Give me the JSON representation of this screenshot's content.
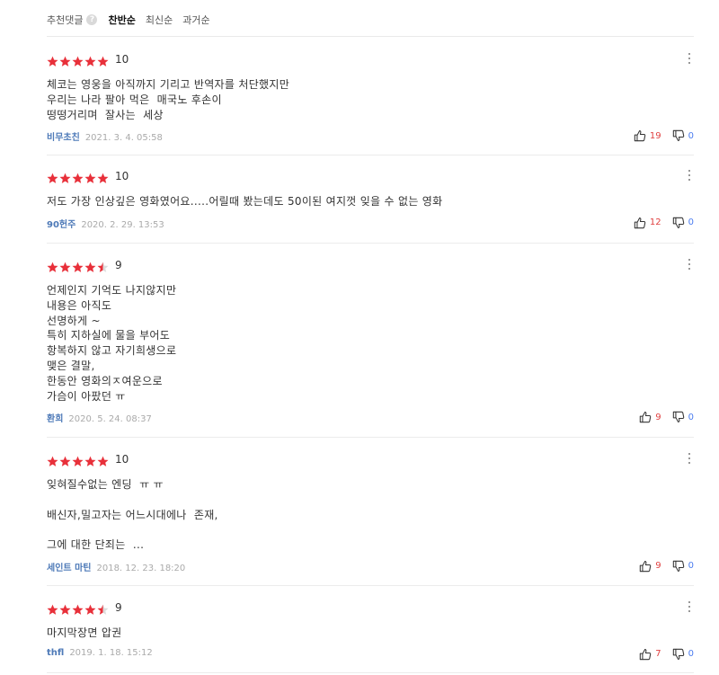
{
  "sort": {
    "label": "추천댓글",
    "help": "?",
    "options": [
      "찬반순",
      "최신순",
      "과거순"
    ]
  },
  "colors": {
    "star": "#e8303a",
    "accent_up": "#e04040",
    "accent_down": "#4a7cf0",
    "author": "#4e7ab8"
  },
  "comments": [
    {
      "stars": 5,
      "score": "10",
      "lines": [
        "체코는 영웅을 아직까지 기리고 반역자를 처단했지만",
        "우리는 나라 팔아 먹은  매국노 후손이",
        "떵떵거리며  잘사는  세상"
      ],
      "author": "비무초친",
      "date": "2021. 3. 4. 05:58",
      "up": "19",
      "down": "0"
    },
    {
      "stars": 5,
      "score": "10",
      "lines": [
        "저도 가장 인상깊은 영화였어요.....어릴때 봤는데도 50이된 여지껏 잊을 수 없는 영화"
      ],
      "author": "90헌주",
      "date": "2020. 2. 29. 13:53",
      "up": "12",
      "down": "0"
    },
    {
      "stars": 4.5,
      "score": "9",
      "lines": [
        "언제인지 기억도 나지않지만",
        "내용은 아직도",
        "선명하게 ~",
        "특히 지하실에 물을 부어도",
        "항복하지 않고 자기희생으로",
        "맺은 결말,",
        "한동안 영화의ㅈ여운으로",
        "가슴이 아팠던 ㅠ"
      ],
      "author": "환희",
      "date": "2020. 5. 24. 08:37",
      "up": "9",
      "down": "0"
    },
    {
      "stars": 5,
      "score": "10",
      "lines": [
        "잊혀질수없는 엔딩  ㅠ ㅠ",
        "",
        "배신자,밀고자는 어느시대에나  존재,",
        "",
        "그에 대한 단죄는  ..."
      ],
      "author": "세인트 마틴",
      "date": "2018. 12. 23. 18:20",
      "up": "9",
      "down": "0"
    },
    {
      "stars": 4.5,
      "score": "9",
      "lines": [
        "마지막장면 압권"
      ],
      "author": "thfl",
      "date": "2019. 1. 18. 15:12",
      "up": "7",
      "down": "0"
    }
  ]
}
